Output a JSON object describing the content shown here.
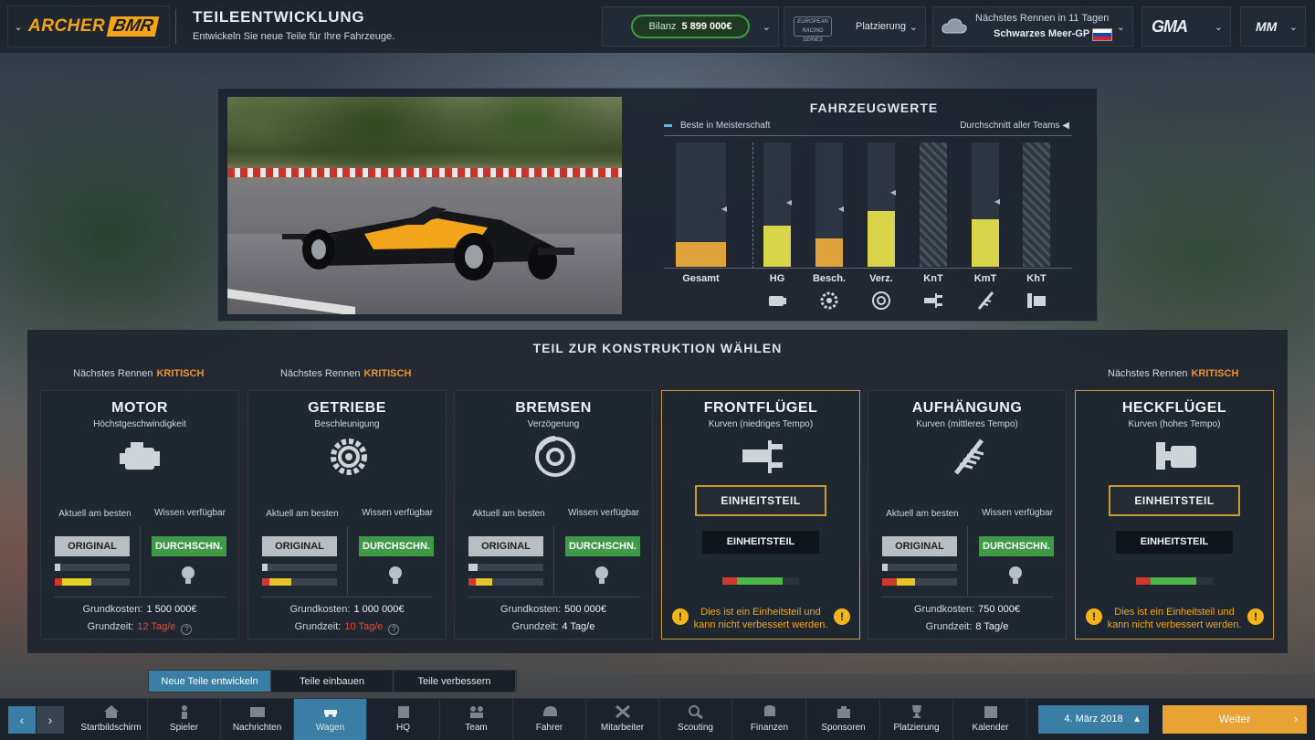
{
  "header": {
    "logo_part1": "ARCHER",
    "logo_part2": "BMR",
    "title": "TEILEENTWICKLUNG",
    "subtitle": "Entwickeln Sie neue Teile für Ihre Fahrzeuge.",
    "bilanz_label": "Bilanz",
    "bilanz_value": "5 899 000€",
    "series_logo": "EUROPEAN RACING SERIES",
    "platzierung_label": "Platzierung",
    "next_race_label": "Nächstes Rennen in 11 Tagen",
    "next_race_name": "Schwarzes Meer-GP",
    "sponsor_logo": "GMA",
    "team_logo": "MM",
    "accent": "#f2a51a"
  },
  "values_panel": {
    "title": "FAHRZEUGWERTE",
    "legend_best": "Beste in Meisterschaft",
    "legend_avg": "Durchschnitt aller Teams",
    "bars": [
      {
        "label": "Gesamt",
        "value": 0.2,
        "avg": 0.5,
        "color": "#e0a23a",
        "icon": "none"
      },
      {
        "label": "HG",
        "value": 0.33,
        "avg": 0.55,
        "color": "#d9d44a",
        "icon": "engine-icon"
      },
      {
        "label": "Besch.",
        "value": 0.23,
        "avg": 0.5,
        "color": "#e0a23a",
        "icon": "gear-icon"
      },
      {
        "label": "Verz.",
        "value": 0.45,
        "avg": 0.63,
        "color": "#d9d44a",
        "icon": "brake-icon"
      },
      {
        "label": "KnT",
        "value": 0,
        "avg": 0,
        "color": "#d9d44a",
        "icon": "front-wing-icon",
        "hatched": true
      },
      {
        "label": "KmT",
        "value": 0.38,
        "avg": 0.56,
        "color": "#d9d44a",
        "icon": "suspension-icon"
      },
      {
        "label": "KhT",
        "value": 0,
        "avg": 0,
        "color": "#d9d44a",
        "icon": "rear-wing-icon",
        "hatched": true
      }
    ]
  },
  "main": {
    "title": "TEIL ZUR KONSTRUKTION WÄHLEN",
    "next_race_label": "Nächstes Rennen",
    "critical_label": "KRITISCH",
    "col_current": "Aktuell am besten",
    "col_knowledge": "Wissen verfügbar",
    "btn_original": "ORIGINAL",
    "btn_durch": "DURCHSCHN.",
    "cost_label": "Grundkosten:",
    "time_label": "Grundzeit:",
    "unit_btn": "EINHEITSTEIL",
    "unit_lbl": "EINHEITSTEIL",
    "unit_warning": "Dies ist ein Einheitsteil und kann nicht verbessert werden.",
    "parts": [
      {
        "name": "MOTOR",
        "desc": "Höchstgeschwindigkeit",
        "cost": "1 500 000€",
        "time": "12 Tag/e"
      },
      {
        "name": "GETRIEBE",
        "desc": "Beschleunigung",
        "cost": "1 000 000€",
        "time": "10 Tag/e"
      },
      {
        "name": "BREMSEN",
        "desc": "Verzögerung",
        "cost": "500 000€",
        "time": "4 Tag/e"
      },
      {
        "name": "FRONTFLÜGEL",
        "desc": "Kurven (niedriges Tempo)"
      },
      {
        "name": "AUFHÄNGUNG",
        "desc": "Kurven (mittleres Tempo)",
        "cost": "750 000€",
        "time": "8 Tag/e"
      },
      {
        "name": "HECKFLÜGEL",
        "desc": "Kurven (hohes Tempo)"
      }
    ]
  },
  "subtabs": [
    "Neue Teile entwickeln",
    "Teile einbauen",
    "Teile verbessern"
  ],
  "nav": [
    "Startbildschirm",
    "Spieler",
    "Nachrichten",
    "Wagen",
    "HQ",
    "Team",
    "Fahrer",
    "Mitarbeiter",
    "Scouting",
    "Finanzen",
    "Sponsoren",
    "Platzierung",
    "Kalender"
  ],
  "date": "4. März 2018",
  "continue_label": "Weiter"
}
